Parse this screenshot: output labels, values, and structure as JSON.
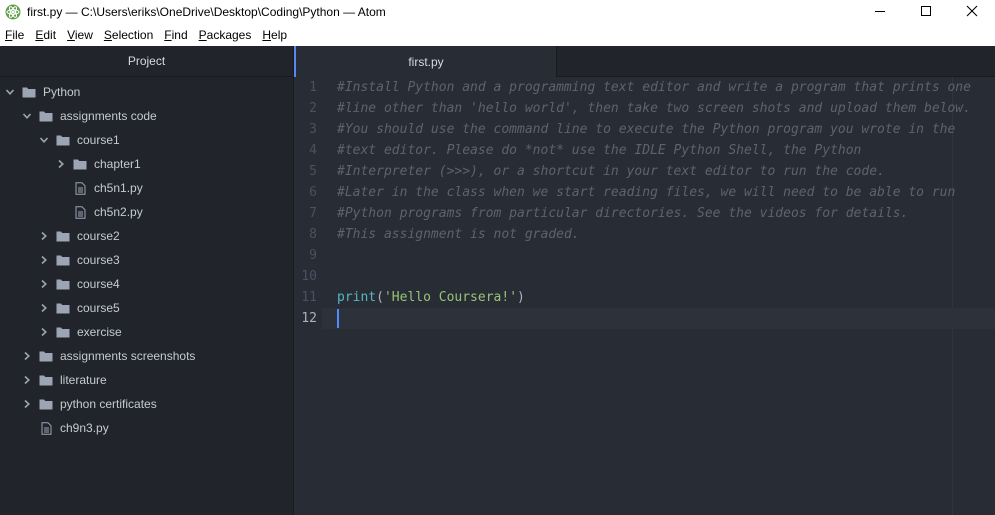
{
  "window": {
    "title": "first.py — C:\\Users\\eriks\\OneDrive\\Desktop\\Coding\\Python — Atom",
    "app_icon": "atom-icon",
    "controls": [
      "minimize-icon",
      "maximize-icon",
      "close-icon"
    ]
  },
  "menu": {
    "items": [
      {
        "key": "F",
        "rest": "ile"
      },
      {
        "key": "E",
        "rest": "dit"
      },
      {
        "key": "V",
        "rest": "iew"
      },
      {
        "key": "S",
        "rest": "election"
      },
      {
        "key": "F",
        "rest": "ind"
      },
      {
        "key": "P",
        "rest": "ackages"
      },
      {
        "key": "H",
        "rest": "elp"
      }
    ]
  },
  "tree": {
    "header": "Project",
    "rows": [
      {
        "label": "Python",
        "type": "folder",
        "expanded": true,
        "depth": 0
      },
      {
        "label": "assignments code",
        "type": "folder",
        "expanded": true,
        "depth": 1
      },
      {
        "label": "course1",
        "type": "folder",
        "expanded": true,
        "depth": 2
      },
      {
        "label": "chapter1",
        "type": "folder",
        "expanded": false,
        "depth": 3
      },
      {
        "label": "ch5n1.py",
        "type": "file",
        "depth": 3
      },
      {
        "label": "ch5n2.py",
        "type": "file",
        "depth": 3
      },
      {
        "label": "course2",
        "type": "folder",
        "expanded": false,
        "depth": 2
      },
      {
        "label": "course3",
        "type": "folder",
        "expanded": false,
        "depth": 2
      },
      {
        "label": "course4",
        "type": "folder",
        "expanded": false,
        "depth": 2
      },
      {
        "label": "course5",
        "type": "folder",
        "expanded": false,
        "depth": 2
      },
      {
        "label": "exercise",
        "type": "folder",
        "expanded": false,
        "depth": 2
      },
      {
        "label": "assignments screenshots",
        "type": "folder",
        "expanded": false,
        "depth": 1
      },
      {
        "label": "literature",
        "type": "folder",
        "expanded": false,
        "depth": 1
      },
      {
        "label": "python certificates",
        "type": "folder",
        "expanded": false,
        "depth": 1
      },
      {
        "label": "ch9n3.py",
        "type": "file",
        "depth": 1
      }
    ]
  },
  "tabs": [
    {
      "label": "first.py",
      "active": true
    }
  ],
  "editor": {
    "active_line": 12,
    "lines": [
      {
        "num": "1",
        "segments": [
          {
            "t": "#Install Python and a programming text editor and write a program that prints one",
            "c": "comment"
          }
        ]
      },
      {
        "num": "2",
        "segments": [
          {
            "t": "#line other than 'hello world', then take two screen shots and upload them below.",
            "c": "comment"
          }
        ]
      },
      {
        "num": "3",
        "segments": [
          {
            "t": "#You should use the command line to execute the Python program you wrote in the",
            "c": "comment"
          }
        ]
      },
      {
        "num": "4",
        "segments": [
          {
            "t": "#text editor. Please do *not* use the IDLE Python Shell, the Python",
            "c": "comment"
          }
        ]
      },
      {
        "num": "5",
        "segments": [
          {
            "t": "#Interpreter (>>>), or a shortcut in your text editor to run the code.",
            "c": "comment"
          }
        ]
      },
      {
        "num": "6",
        "segments": [
          {
            "t": "#Later in the class when we start reading files, we will need to be able to run",
            "c": "comment"
          }
        ]
      },
      {
        "num": "7",
        "segments": [
          {
            "t": "#Python programs from particular directories. See the videos for details.",
            "c": "comment"
          }
        ]
      },
      {
        "num": "8",
        "segments": [
          {
            "t": "#This assignment is not graded.",
            "c": "comment"
          }
        ]
      },
      {
        "num": "9",
        "segments": []
      },
      {
        "num": "10",
        "segments": []
      },
      {
        "num": "11",
        "segments": [
          {
            "t": "print",
            "c": "fn"
          },
          {
            "t": "(",
            "c": "punc"
          },
          {
            "t": "'Hello Coursera!'",
            "c": "str"
          },
          {
            "t": ")",
            "c": "punc"
          }
        ]
      },
      {
        "num": "12",
        "segments": []
      }
    ]
  },
  "colors": {
    "accent": "#568af2",
    "folder": "#9da5b4"
  }
}
